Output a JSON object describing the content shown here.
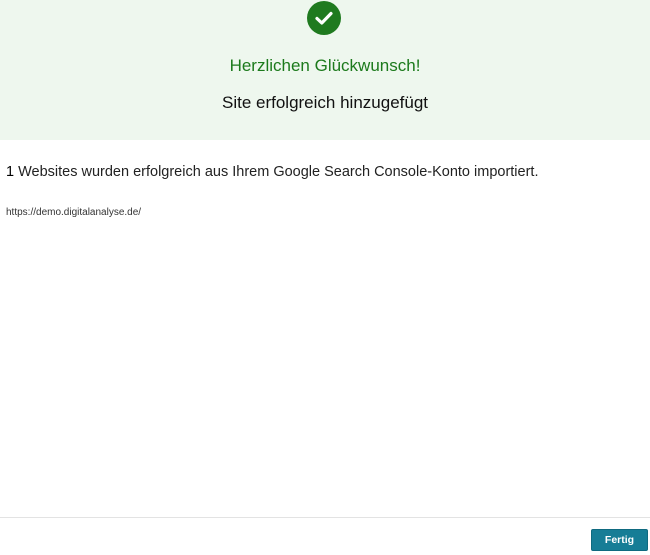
{
  "banner": {
    "icon": "check-circle-icon",
    "icon_color": "#1f7a1f",
    "background": "#eef7ee",
    "title": "Herzlichen Glückwunsch!",
    "subtitle": "Site erfolgreich hinzugefügt"
  },
  "main": {
    "count": "1",
    "message": " Websites wurden erfolgreich aus Ihrem Google Search Console-Konto importiert.",
    "sites": [
      "https://demo.digitalanalyse.de/"
    ]
  },
  "footer": {
    "done_label": "Fertig",
    "button_color": "#167d96"
  }
}
